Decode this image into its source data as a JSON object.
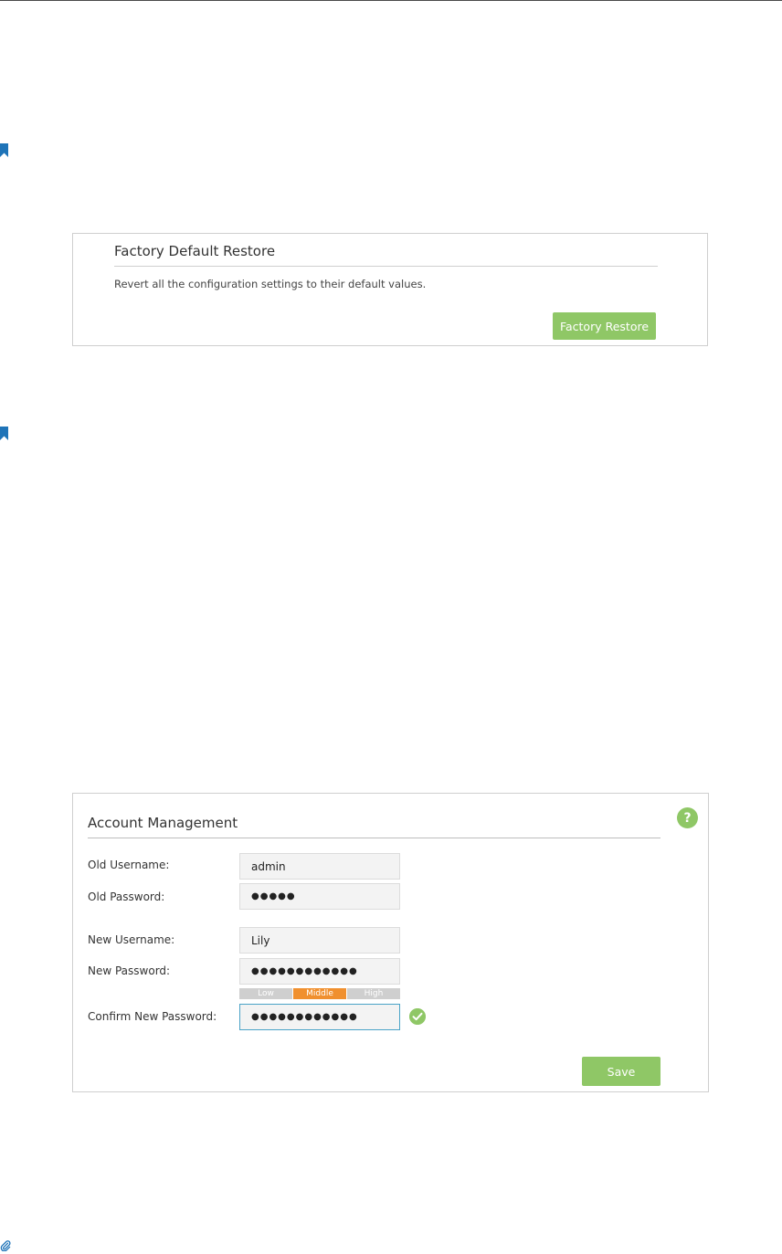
{
  "factory_restore": {
    "title": "Factory Default Restore",
    "description": "Revert all the configuration settings to their default values.",
    "button_label": "Factory Restore"
  },
  "account_management": {
    "title": "Account Management",
    "help_icon": "?",
    "fields": {
      "old_username": {
        "label": "Old Username:",
        "value": "admin"
      },
      "old_password": {
        "label": "Old Password:",
        "value": "●●●●●"
      },
      "new_username": {
        "label": "New Username:",
        "value": "Lily"
      },
      "new_password": {
        "label": "New Password:",
        "value": "●●●●●●●●●●●●"
      },
      "confirm_password": {
        "label": "Confirm New Password:",
        "value": "●●●●●●●●●●●●"
      }
    },
    "strength": {
      "low": "Low",
      "middle": "Middle",
      "high": "High",
      "selected": "Middle"
    },
    "save_label": "Save"
  },
  "colors": {
    "accent_green": "#8fc766",
    "strength_orange": "#f0902f",
    "bookmark_blue": "#1f74b8",
    "focus_border": "#4aa3c7"
  },
  "icons": [
    "bookmark-icon",
    "help-icon",
    "check-icon",
    "paperclip-icon"
  ]
}
